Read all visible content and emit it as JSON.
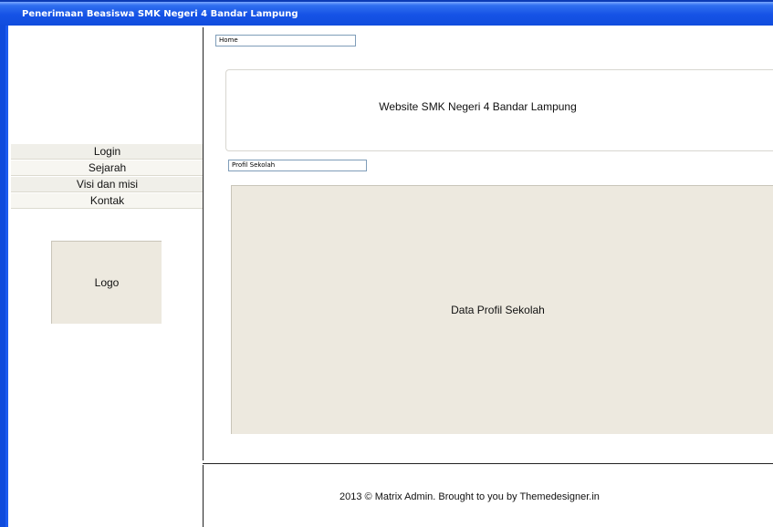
{
  "window": {
    "title": "Penerimaan Beasiswa SMK Negeri 4 Bandar Lampung"
  },
  "sidebar": {
    "items": [
      {
        "label": "Login"
      },
      {
        "label": "Sejarah"
      },
      {
        "label": "Visi dan misi"
      },
      {
        "label": "Kontak"
      }
    ],
    "logo_label": "Logo"
  },
  "main": {
    "breadcrumb": "Home",
    "hero_text": "Website SMK Negeri 4 Bandar Lampung",
    "section_field": "Profil Sekolah",
    "data_panel_text": "Data Profil Sekolah"
  },
  "footer": {
    "text": "2013 © Matrix Admin. Brought to you by Themedesigner.in"
  },
  "colors": {
    "titlebar": "#0f4bdc",
    "panel_fill": "#ede9df",
    "nav_fill": "#f0efe9"
  }
}
